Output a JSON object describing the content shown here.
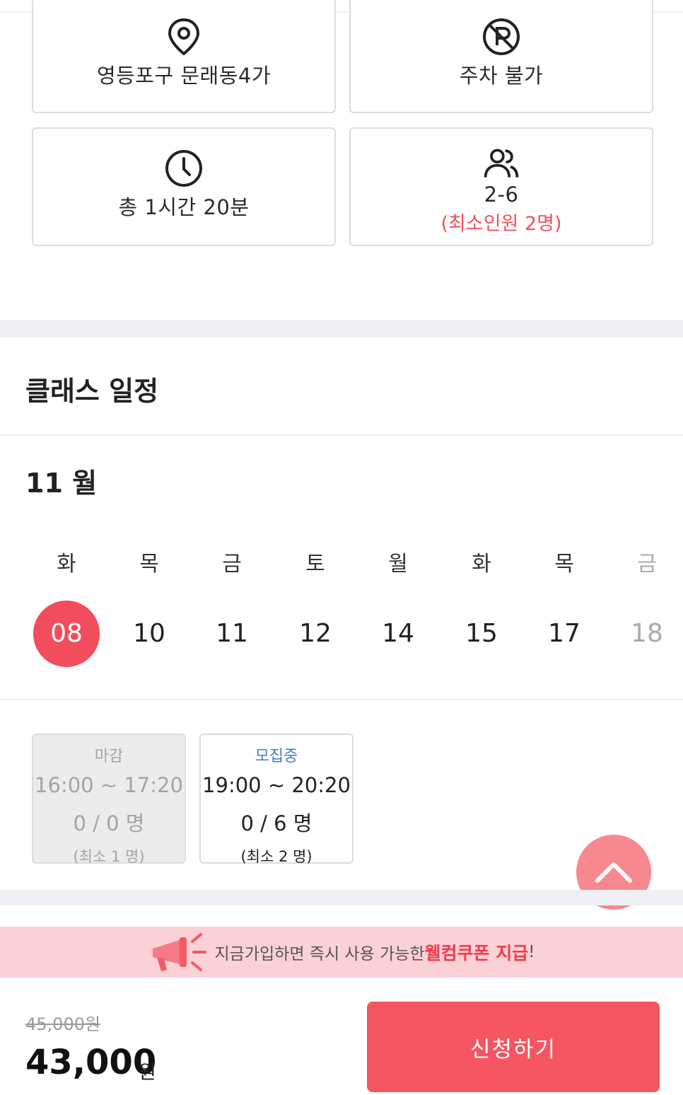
{
  "info": {
    "location": "영등포구 문래동4가",
    "parking": "주차 불가",
    "duration": "총 1시간 20분",
    "capacity": "2-6",
    "capacity_min": "(최소인원 2명)"
  },
  "schedule": {
    "title": "클래스 일정",
    "month": "11 월",
    "days": [
      {
        "dow": "화",
        "date": "08",
        "selected": true
      },
      {
        "dow": "목",
        "date": "10"
      },
      {
        "dow": "금",
        "date": "11"
      },
      {
        "dow": "토",
        "date": "12"
      },
      {
        "dow": "월",
        "date": "14"
      },
      {
        "dow": "화",
        "date": "15"
      },
      {
        "dow": "목",
        "date": "17"
      },
      {
        "dow": "금",
        "date": "18",
        "dim": true
      }
    ],
    "slots": [
      {
        "status": "마감",
        "time": "16:00 ~ 17:20",
        "count": "0 / 0 명",
        "minimum": "(최소 1 명)"
      },
      {
        "status": "모집중",
        "time": "19:00 ~ 20:20",
        "count": "0 / 6 명",
        "minimum": "(최소 2 명)"
      }
    ]
  },
  "promo": {
    "text": "지금가입하면 즉시 사용 가능한 ",
    "highlight": "웰컴쿠폰 지급",
    "suffix": "!"
  },
  "purchase": {
    "original_price": "45,000원",
    "price": "43,000",
    "currency": "원",
    "apply_label": "신청하기"
  },
  "colors": {
    "accent": "#f45561",
    "selected_date": "#f24d5d",
    "open_status": "#4a78c8",
    "promo_bg": "#fcd1d5"
  }
}
